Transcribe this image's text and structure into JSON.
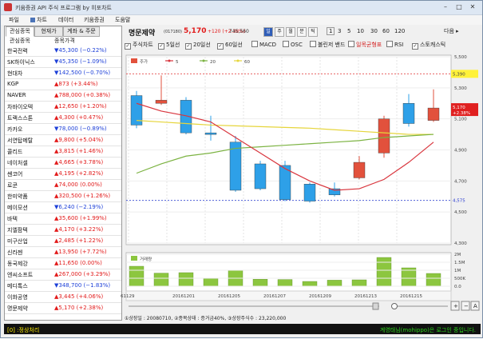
{
  "window": {
    "title": "키움증권 API 주식 프로그램 by 히포차트"
  },
  "menu": [
    {
      "label": "파일",
      "icon": ""
    },
    {
      "label": "차트",
      "icon": "chart-icon"
    },
    {
      "label": "데이터",
      "icon": ""
    },
    {
      "label": "키움증권",
      "icon": ""
    },
    {
      "label": "도움말",
      "icon": ""
    }
  ],
  "left_panel": {
    "tabs": [
      "관심종목",
      "현재가",
      "계좌 & 주문"
    ],
    "headers": [
      "관심종목",
      "종목가격"
    ],
    "items": [
      {
        "name": "한국전력",
        "dir": "down",
        "text": "▼45,300 (−0.22%)"
      },
      {
        "name": "SK하이닉스",
        "dir": "down",
        "text": "▼45,350 (−1.09%)"
      },
      {
        "name": "현대차",
        "dir": "down",
        "text": "▼142,500 (−0.70%)"
      },
      {
        "name": "KGP",
        "dir": "up",
        "text": "▲873 (+3.44%)"
      },
      {
        "name": "NAVER",
        "dir": "up",
        "text": "▲788,000 (+0.38%)"
      },
      {
        "name": "차바이오텍",
        "dir": "up",
        "text": "▲12,650 (+1.20%)"
      },
      {
        "name": "트랙스스톤",
        "dir": "up",
        "text": "▲4,300 (+0.47%)"
      },
      {
        "name": "카카오",
        "dir": "down",
        "text": "▼78,000 (−0.89%)"
      },
      {
        "name": "서연탑메탈",
        "dir": "up",
        "text": "▲9,800 (+5.04%)"
      },
      {
        "name": "콜리드",
        "dir": "up",
        "text": "▲3,815 (+1.46%)"
      },
      {
        "name": "네이처셀",
        "dir": "up",
        "text": "▲4,665 (+3.78%)"
      },
      {
        "name": "쎈코어",
        "dir": "up",
        "text": "▲4,195 (+2.82%)"
      },
      {
        "name": "로쿤",
        "dir": "up",
        "text": "▲74,000 (0.00%)"
      },
      {
        "name": "한미약품",
        "dir": "up",
        "text": "▲320,500 (+1.26%)"
      },
      {
        "name": "메이모션",
        "dir": "down",
        "text": "▼6,240 (−2.19%)"
      },
      {
        "name": "바텍",
        "dir": "up",
        "text": "▲35,600 (+1.99%)"
      },
      {
        "name": "지엘팜텍",
        "dir": "up",
        "text": "▲4,170 (+3.22%)"
      },
      {
        "name": "미구산업",
        "dir": "up",
        "text": "▲2,485 (+1.22%)"
      },
      {
        "name": "신라젠",
        "dir": "up",
        "text": "▲13,950 (+7.72%)"
      },
      {
        "name": "동국제강",
        "dir": "up",
        "text": "▲11,650 (0.00%)"
      },
      {
        "name": "엔씨소프트",
        "dir": "up",
        "text": "▲267,000 (+3.29%)"
      },
      {
        "name": "메디톡스",
        "dir": "down",
        "text": "▼348,700 (−1.83%)"
      },
      {
        "name": "이화공영",
        "dir": "up",
        "text": "▲3,445 (+4.06%)"
      },
      {
        "name": "명문제약",
        "dir": "up",
        "text": "▲5,170 (+2.38%)"
      }
    ]
  },
  "stock_header": {
    "name": "명문제약",
    "code": "(017180)",
    "price": "5,170",
    "change": "+120 (+2.38%)",
    "volume": "745,560"
  },
  "periods": [
    "일",
    "주",
    "월",
    "분",
    "틱"
  ],
  "active_period": "일",
  "intervals": [
    "1",
    "3",
    "5",
    "10",
    "30",
    "60",
    "120"
  ],
  "active_interval": "1",
  "next_label": "다음 ▸",
  "indicators": [
    {
      "label": "주식차트",
      "checked": true
    },
    {
      "label": "5일선",
      "checked": true
    },
    {
      "label": "20일선",
      "checked": true
    },
    {
      "label": "60일선",
      "checked": true
    },
    {
      "label": "MACD",
      "checked": false
    },
    {
      "label": "OSC",
      "checked": false
    },
    {
      "label": "볼린저 밴드",
      "checked": false
    },
    {
      "label": "일목균형표",
      "checked": false
    },
    {
      "label": "RSI",
      "checked": false
    },
    {
      "label": "스토캐스틱",
      "checked": true
    }
  ],
  "colors": {
    "up": "#e21a1a",
    "down": "#1c3fd8",
    "ma5": "#d9363e",
    "ma20": "#7cb342",
    "ma60": "#e6d53b",
    "candle_up": "#e2513c",
    "candle_down": "#2ea0e8",
    "volume": "#8cc63f",
    "highlight": "#fff23a"
  },
  "chart_data": [
    {
      "type": "candlestick",
      "title": "",
      "legend": [
        "주가",
        "5",
        "20",
        "60"
      ],
      "y_ticks": [
        "5,500",
        "5,300",
        "5,100",
        "4,900",
        "4,700",
        "4,500",
        "4,300"
      ],
      "ylim": [
        4300,
        5500
      ],
      "ref_lines": {
        "high": 5390,
        "low": 4575
      },
      "current_label": "5,170\n+2.38%",
      "x_labels": [
        "61129",
        "20161201",
        "20161205",
        "20161207",
        "20161209",
        "20161213",
        "20161215"
      ],
      "candles": [
        {
          "open": 5250,
          "close": 5060,
          "high": 5280,
          "low": 5040,
          "dir": "down"
        },
        {
          "open": 5200,
          "close": 5220,
          "high": 5380,
          "low": 5190,
          "dir": "up"
        },
        {
          "open": 5220,
          "close": 5010,
          "high": 5240,
          "low": 5000,
          "dir": "down"
        },
        {
          "open": 5010,
          "close": 5000,
          "high": 5120,
          "low": 4960,
          "dir": "down"
        },
        {
          "open": 4950,
          "close": 4640,
          "high": 4990,
          "low": 4630,
          "dir": "down"
        },
        {
          "open": 4810,
          "close": 4650,
          "high": 4830,
          "low": 4640,
          "dir": "down"
        },
        {
          "open": 4800,
          "close": 4580,
          "high": 4830,
          "low": 4570,
          "dir": "down"
        },
        {
          "open": 4680,
          "close": 4570,
          "high": 4690,
          "low": 4560,
          "dir": "down"
        },
        {
          "open": 4650,
          "close": 4610,
          "high": 4690,
          "low": 4600,
          "dir": "down"
        },
        {
          "open": 4720,
          "close": 4820,
          "high": 4860,
          "low": 4710,
          "dir": "up"
        },
        {
          "open": 4880,
          "close": 5100,
          "high": 5120,
          "low": 4850,
          "dir": "up"
        },
        {
          "open": 5070,
          "close": 5200,
          "high": 5260,
          "low": 5050,
          "dir": "down"
        },
        {
          "open": 5170,
          "close": 5090,
          "high": 5290,
          "low": 5080,
          "dir": "up"
        }
      ],
      "ma5": [
        5200,
        5150,
        5120,
        5080,
        4980,
        4880,
        4780,
        4700,
        4640,
        4650,
        4710,
        4820,
        4950
      ],
      "ma20": [
        4750,
        4810,
        4860,
        4880,
        4910,
        4920,
        4930,
        4940,
        4950,
        4960,
        4980,
        4990,
        5000
      ],
      "ma60": [
        5090,
        5080,
        5070,
        5060,
        5055,
        5050,
        5045,
        5040,
        5030,
        5020,
        5010,
        5000,
        5000
      ]
    },
    {
      "type": "bar",
      "title": "",
      "legend": [
        "거래량"
      ],
      "y_ticks": [
        "2M",
        "1.5M",
        "1M",
        "500K",
        "0.0"
      ],
      "ylim": [
        0,
        2000000
      ],
      "values": [
        1250000,
        820000,
        850000,
        480000,
        1000000,
        440000,
        420000,
        300000,
        380000,
        400000,
        1800000,
        1150000,
        800000
      ]
    }
  ],
  "scroll": {
    "buttons": [
      "+",
      "−",
      "A"
    ]
  },
  "status_line": "①상장일 : 20080710,  ②종목상태 : 증거금40%,  ③상장주식수 : 23,220,000",
  "bottom": {
    "left": "[0] :정상처리",
    "right": "계영태님(mohippo)은 로그인 중입니다."
  }
}
